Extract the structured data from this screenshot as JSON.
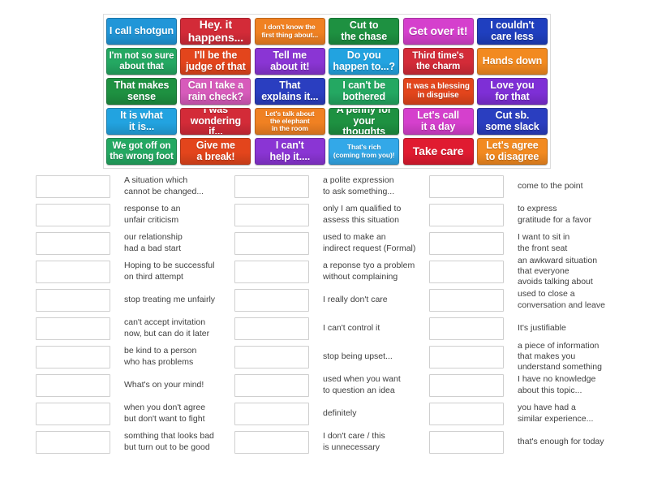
{
  "tiles": {
    "rows": [
      [
        {
          "label": "I call shotgun",
          "color": "#2196d8",
          "size": "fs-lg"
        },
        {
          "label": "Hey. it\nhappens...",
          "color": "#d32b38",
          "size": "fs-xxl"
        },
        {
          "label": "I don't know the\nfirst thing about...",
          "color": "#f08122",
          "size": "fs-xs"
        },
        {
          "label": "Cut to\nthe chase",
          "color": "#1e9141",
          "size": "fs-lg"
        },
        {
          "label": "Get over it!",
          "color": "#d540cd",
          "size": "fs-xxl"
        },
        {
          "label": "I couldn't\ncare less",
          "color": "#1f3fbf",
          "size": "fs-lg"
        }
      ],
      [
        {
          "label": "I'm not so sure\nabout that",
          "color": "#24a862",
          "size": "fs-md"
        },
        {
          "label": "I'll be the\njudge of that",
          "color": "#e3451c",
          "size": "fs-lg"
        },
        {
          "label": "Tell me\nabout it!",
          "color": "#8a35d4",
          "size": "fs-lg"
        },
        {
          "label": "Do you\nhappen to...?",
          "color": "#22a3e0",
          "size": "fs-lg"
        },
        {
          "label": "Third time's\nthe charm",
          "color": "#d32b38",
          "size": "fs-md"
        },
        {
          "label": "Hands down",
          "color": "#f28a20",
          "size": "fs-lg"
        }
      ],
      [
        {
          "label": "That makes\nsense",
          "color": "#1e9141",
          "size": "fs-lg"
        },
        {
          "label": "Can I take a\nrain check?",
          "color": "#d75bbb",
          "size": "fs-lg"
        },
        {
          "label": "That\nexplains it...",
          "color": "#2a3ec0",
          "size": "fs-lg"
        },
        {
          "label": "I can't be\nbothered",
          "color": "#24a862",
          "size": "fs-lg"
        },
        {
          "label": "It was a blessing\nin disguise",
          "color": "#e3451c",
          "size": "fs-sm"
        },
        {
          "label": "Love you\nfor that",
          "color": "#7e2fd6",
          "size": "fs-lg"
        }
      ],
      [
        {
          "label": "It is what\nit is...",
          "color": "#22a3e0",
          "size": "fs-lg"
        },
        {
          "label": "I was\nwondering if...",
          "color": "#d32b38",
          "size": "fs-lg"
        },
        {
          "label": "Let's talk about\nthe elephant\nin the room",
          "color": "#f08122",
          "size": "fs-xs"
        },
        {
          "label": "A penny for\nyour thoughts",
          "color": "#1e9141",
          "size": "fs-lg"
        },
        {
          "label": "Let's call\nit a day",
          "color": "#d540cd",
          "size": "fs-lg"
        },
        {
          "label": "Cut sb.\nsome slack",
          "color": "#2a3ec0",
          "size": "fs-lg"
        }
      ],
      [
        {
          "label": "We got off on\nthe wrong foot",
          "color": "#24a862",
          "size": "fs-md"
        },
        {
          "label": "Give me\na break!",
          "color": "#e3451c",
          "size": "fs-lg"
        },
        {
          "label": "I can't\nhelp it....",
          "color": "#8a35d4",
          "size": "fs-lg"
        },
        {
          "label": "That's rich\n(coming from you)!",
          "color": "#33a8e8",
          "size": "fs-xs"
        },
        {
          "label": "Take care",
          "color": "#e01b30",
          "size": "fs-xxl"
        },
        {
          "label": "Let's agree\nto disagree",
          "color": "#f28a20",
          "size": "fs-lg"
        }
      ]
    ]
  },
  "answers": {
    "column_1": [
      "A situation which\ncannot be changed...",
      "response to an\nunfair criticism",
      "our relationship\nhad a bad start",
      "Hoping to be successful\non third attempt",
      "stop treating me unfairly",
      "can't accept invitation\nnow, but can do it later",
      "be kind to a person\nwho has problems",
      "What's on your mind!",
      "when you don't agree\nbut don't want to fight",
      "somthing that looks bad\nbut turn out to be good"
    ],
    "column_2": [
      "a polite expression\nto ask something...",
      "only I am qualified to\nassess this situation",
      "used to make an\nindirect request (Formal)",
      "a reponse tyo a problem\nwithout complaining",
      "I really don't care",
      "I can't control it",
      "stop being upset...",
      "used when you want\nto question an idea",
      "definitely",
      "I don't care / this\nis unnecessary"
    ],
    "column_3": [
      "come to the point",
      "to express\ngratitude for a favor",
      "I want to sit in\nthe front seat",
      "an awkward situation\nthat everyone\navoids talking about",
      "used to close a\nconversation and leave",
      "It's justifiable",
      "a piece of information\nthat makes you\nunderstand something",
      "I have no knowledge\nabout this topic...",
      "you have had a\nsimilar experience...",
      "that's enough for today"
    ]
  }
}
